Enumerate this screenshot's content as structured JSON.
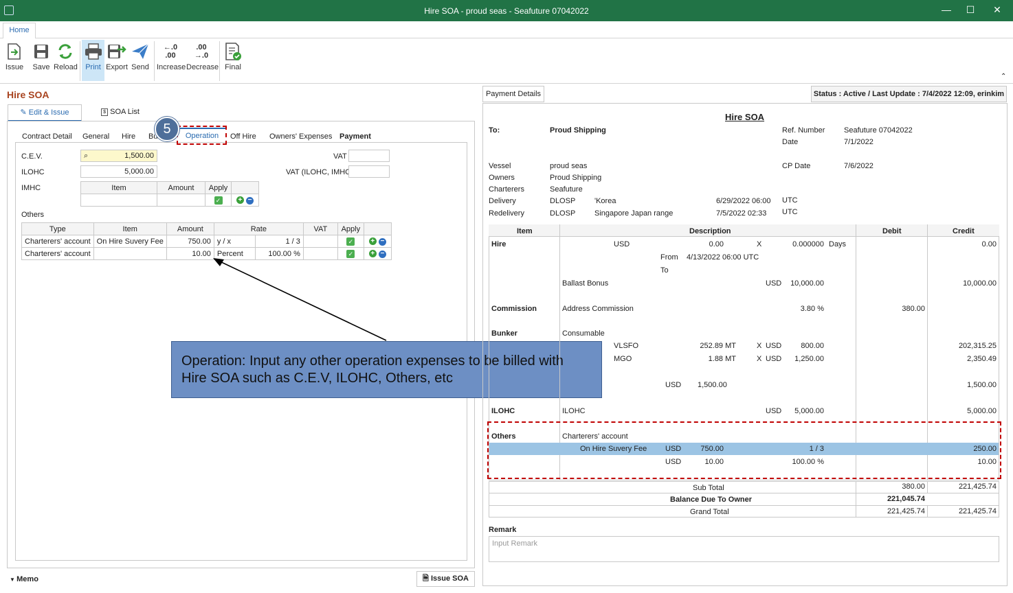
{
  "window": {
    "title": "Hire SOA - proud seas - Seafuture 07042022",
    "min": "—",
    "max": "☐",
    "close": "✕"
  },
  "ribbon": {
    "tab": "Home",
    "buttons": [
      "Issue",
      "Save",
      "Reload",
      "Print",
      "Export",
      "Send",
      "Increase",
      "Decrease",
      "Final"
    ],
    "increase_glyph": "←.0\n.00",
    "decrease_glyph": ".00\n→.0",
    "selected": "Print",
    "accent": "#217346"
  },
  "left": {
    "title": "Hire SOA",
    "tabs": [
      "Edit & Issue",
      "SOA List"
    ],
    "subtabs": [
      "Contract Detail",
      "General",
      "Hire",
      "Bu",
      "Operation",
      "Off Hire",
      "Owners' Expenses",
      "Payment"
    ],
    "step": "5",
    "cev": {
      "label": "C.E.V.",
      "value": "1,500.00"
    },
    "ilohc": {
      "label": "ILOHC",
      "value": "5,000.00"
    },
    "imhc": {
      "label": "IMHC",
      "cols": [
        "Item",
        "Amount",
        "Apply"
      ]
    },
    "vat": {
      "label": "VAT",
      "value": ""
    },
    "vat2": {
      "label": "VAT (ILOHC, IMHC)",
      "value": ""
    },
    "others": {
      "label": "Others",
      "cols": [
        "Type",
        "Item",
        "Amount",
        "Rate",
        "",
        "VAT",
        "Apply"
      ],
      "rows": [
        {
          "type": "Charterers' account",
          "item": "On Hire Suvery Fee",
          "amount": "750.00",
          "rate_unit": "y / x",
          "rate": "1 / 3"
        },
        {
          "type": "Charterers' account",
          "item": "",
          "amount": "10.00",
          "rate_unit": "Percent",
          "rate": "100.00 %"
        }
      ]
    },
    "callout": "Operation: Input any other operation expenses to be billed with Hire SOA such as C.E.V, ILOHC, Others, etc",
    "memo": "Memo",
    "issue_btn": "Issue SOA"
  },
  "right": {
    "payment_tab": "Payment Details",
    "status": "Status : Active /  Last Update : 7/4/2022 12:09, erinkim",
    "title": "Hire SOA",
    "to_label": "To:",
    "to": "Proud Shipping",
    "ref_label": "Ref. Number",
    "ref": "Seafuture 07042022",
    "date_label": "Date",
    "date": "7/1/2022",
    "cp_label": "CP Date",
    "cp": "7/6/2022",
    "vessel_label": "Vessel",
    "vessel": "proud seas",
    "owners_label": "Owners",
    "owners": "Proud Shipping",
    "charterers_label": "Charterers",
    "charterers": "Seafuture",
    "delivery_label": "Delivery",
    "delivery_code": "DLOSP",
    "delivery_place": "'Korea",
    "delivery_time": "6/29/2022 06:00",
    "delivery_tz": "UTC",
    "redelivery_label": "Redelivery",
    "redelivery_code": "DLOSP",
    "redelivery_place": "Singapore Japan range",
    "redelivery_time": "7/5/2022 02:33",
    "redelivery_tz": "UTC",
    "cols": [
      "Item",
      "Description",
      "Debit",
      "Credit"
    ],
    "hire": {
      "label": "Hire",
      "cur": "USD",
      "amt": "0.00",
      "x": "X",
      "rate": "0.000000",
      "unit": "Days",
      "credit": "0.00",
      "from_label": "From",
      "from": "4/13/2022 06:00 UTC",
      "to_label": "To",
      "bonus": "Ballast Bonus",
      "bonus_cur": "USD",
      "bonus_amt": "10,000.00",
      "bonus_credit": "10,000.00"
    },
    "commission": {
      "label": "Commission",
      "desc": "Address Commission",
      "pct": "3.80 %",
      "debit": "380.00"
    },
    "bunker": {
      "label": "Bunker",
      "desc": "Consumable",
      "r1": {
        "fuel": "VLSFO",
        "qty": "252.89 MT",
        "x": "X",
        "cur": "USD",
        "price": "800.00",
        "credit": "202,315.25"
      },
      "r2": {
        "fuel": "MGO",
        "qty": "1.88 MT",
        "x": "X",
        "cur": "USD",
        "price": "1,250.00",
        "credit": "2,350.49"
      }
    },
    "cev": {
      "cur": "USD",
      "amt": "1,500.00",
      "credit": "1,500.00"
    },
    "ilohc": {
      "label": "ILOHC",
      "desc": "ILOHC",
      "cur": "USD",
      "amt": "5,000.00",
      "credit": "5,000.00"
    },
    "others": {
      "label": "Others",
      "desc": "Charterers' account",
      "r1": {
        "item": "On Hire Suvery Fee",
        "cur": "USD",
        "amt": "750.00",
        "rate": "1 / 3",
        "credit": "250.00"
      },
      "r2": {
        "cur": "USD",
        "amt": "10.00",
        "rate": "100.00 %",
        "credit": "10.00"
      }
    },
    "subtotal": {
      "label": "Sub Total",
      "debit": "380.00",
      "credit": "221,425.74"
    },
    "balance": {
      "label": "Balance Due To Owner",
      "value": "221,045.74"
    },
    "grand": {
      "label": "Grand Total",
      "debit": "221,425.74",
      "credit": "221,425.74"
    },
    "remark_label": "Remark",
    "remark_placeholder": "Input Remark"
  }
}
